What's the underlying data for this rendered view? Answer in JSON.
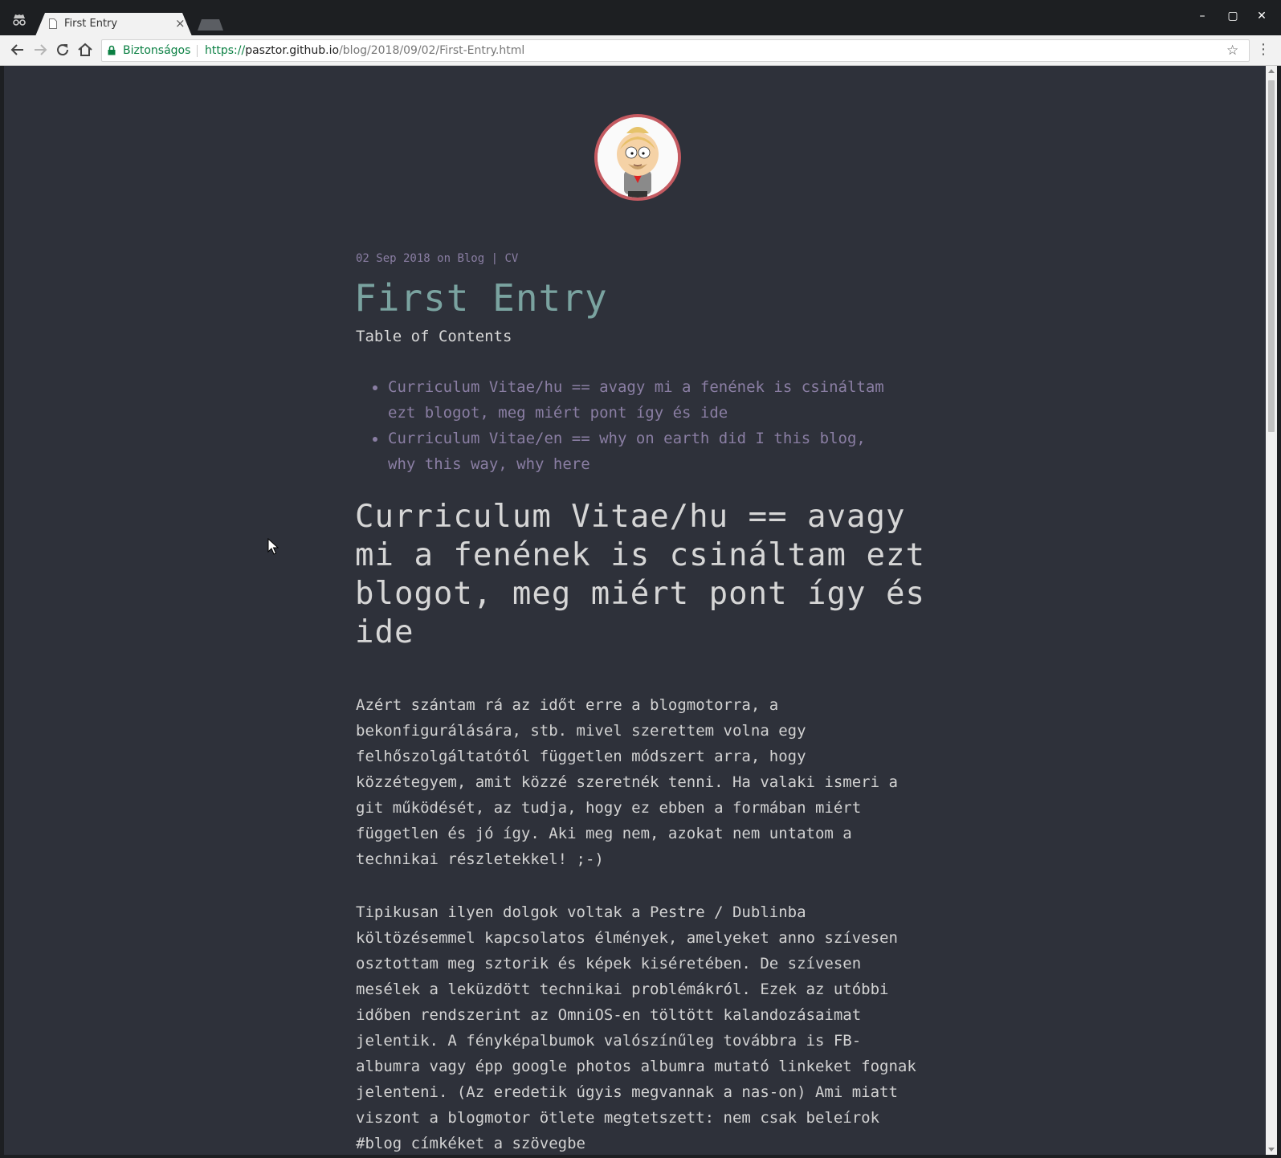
{
  "browser": {
    "tab_title": "First Entry",
    "tab_close": "×",
    "window_controls": {
      "minimize": "–",
      "maximize": "▢",
      "close": "✕"
    },
    "security_label": "Biztonságos",
    "url": {
      "scheme": "https://",
      "host": "pasztor.github.io",
      "path": "/blog/2018/09/02/First-Entry.html"
    },
    "bookmark_icon": "☆",
    "menu_icon": "⋮",
    "icons": [
      "incognito-icon",
      "page-icon",
      "back-icon",
      "forward-icon",
      "reload-icon",
      "home-icon",
      "lock-icon",
      "star-icon",
      "menu-icon"
    ]
  },
  "page": {
    "meta": {
      "date": "02 Sep 2018",
      "on": "on",
      "blog_link": "Blog",
      "divider": "|",
      "cv_link": "CV"
    },
    "title": "First Entry",
    "toc_title": "Table of Contents",
    "toc": [
      {
        "line1": "Curriculum Vitae/hu == avagy mi a fenének is csináltam",
        "line2": "ezt blogot, meg miért pont így és ide"
      },
      {
        "line1": "Curriculum Vitae/en == why on earth did I this blog,",
        "line2": "why this way, why here"
      }
    ],
    "heading": "Curriculum Vitae/hu == avagy mi a fenének is csináltam ezt blogot, meg miért pont így és ide",
    "paragraph1": "Azért szántam rá az időt erre a blogmotorra, a bekonfigurálására, stb. mivel szerettem volna egy felhőszolgáltatótól független módszert arra, hogy közzétegyem, amit közzé szeretnék tenni. Ha valaki ismeri a git működését, az tudja, hogy ez ebben a formában miért független és jó így. Aki meg nem, azokat nem untatom a technikai részletekkel! ;-)",
    "paragraph2": "Tipikusan ilyen dolgok voltak a Pestre / Dublinba költözésemmel kapcsolatos élmények, amelyeket anno szívesen osztottam meg sztorik és képek kiséretében. De szívesen mesélek a leküzdött technikai problémákról. Ezek az utóbbi időben rendszerint az OmniOS-en töltött kalandozásaimat jelentik. A fényképalbumok valószínűleg továbbra is FB-albumra vagy épp google photos albumra mutató linkeket fognak jelenteni. (Az eredetik úgyis megvannak a nas-on) Ami miatt viszont a blogmotor ötlete megtetszett: nem csak beleírok #blog címkéket a szövegbe"
  },
  "colors": {
    "page_bg": "#2e313a",
    "title": "#7aa3a0",
    "link": "#8a7ea3",
    "text": "#d2d2d2",
    "avatar_ring": "#c45a61",
    "secure_green": "#0b8043"
  }
}
